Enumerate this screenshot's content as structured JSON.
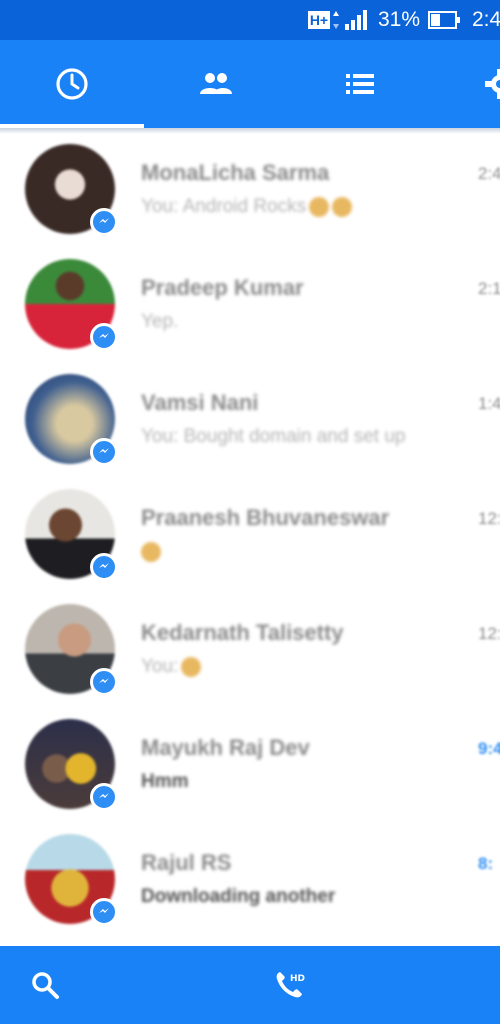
{
  "status_bar": {
    "network": "H+",
    "battery": "31%",
    "time": "2:4"
  },
  "tabs": [
    {
      "icon": "clock-icon",
      "active": true
    },
    {
      "icon": "people-icon",
      "active": false
    },
    {
      "icon": "list-icon",
      "active": false
    },
    {
      "icon": "gear-icon",
      "active": false
    }
  ],
  "colors": {
    "status_bar": "#0b63d9",
    "header": "#1a82f7",
    "badge": "#2f8ef4"
  },
  "conversations": [
    {
      "name": "MonaLicha Sarma",
      "preview": "You: Android Rocks",
      "time": "2:4",
      "unread": false
    },
    {
      "name": "Pradeep Kumar",
      "preview": "Yep.",
      "time": "2:1",
      "unread": false
    },
    {
      "name": "Vamsi Nani",
      "preview": "You: Bought domain and set up",
      "time": "1:4",
      "unread": false
    },
    {
      "name": "Praanesh Bhuvaneswar",
      "preview": "",
      "time": "12:",
      "unread": false
    },
    {
      "name": "Kedarnath Talisetty",
      "preview": "You:",
      "time": "12:",
      "unread": false
    },
    {
      "name": "Mayukh Raj Dev",
      "preview": "Hmm",
      "time": "9:4",
      "unread": true
    },
    {
      "name": "Rajul RS",
      "preview": "Downloading another",
      "time": "8:",
      "unread": true
    }
  ],
  "bottom_bar": {
    "left_icon": "search-icon",
    "right_icon": "hd-call-icon"
  }
}
